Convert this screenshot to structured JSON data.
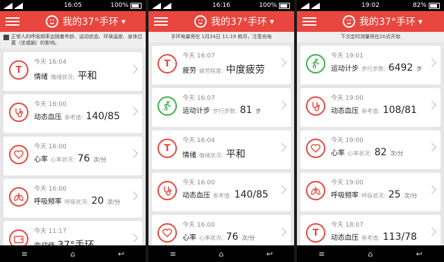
{
  "colors": {
    "accent": "#e8463e",
    "green": "#3cb14a"
  },
  "screens": [
    {
      "status": {
        "time": "16:05",
        "battery": "100%"
      },
      "app_title": "我的37°手环",
      "notice": "正常人的呼吸频率会随着年龄、运动状态、环境温度、身体位置（坐或躺）的影响。",
      "cards": [
        {
          "icon": "T",
          "icon_name": "mood-icon",
          "time": "今天 16:04",
          "name": "情绪",
          "label": "情绪状况:",
          "value": "平和",
          "unit": ""
        },
        {
          "icon": "bp",
          "icon_name": "stethoscope-icon",
          "time": "今天 16:00",
          "name": "动态血压",
          "label": "参考值:",
          "value": "140/85",
          "unit": ""
        },
        {
          "icon": "heart",
          "icon_name": "heart-icon",
          "time": "今天 16:00",
          "name": "心率",
          "label": "心率状况:",
          "value": "76",
          "unit": "次/分"
        },
        {
          "icon": "lung",
          "icon_name": "lungs-icon",
          "time": "今天 16:00",
          "name": "呼吸频率",
          "label": "呼吸状况:",
          "value": "20",
          "unit": "次/分"
        },
        {
          "icon": "wallet",
          "icon_name": "wallet-icon",
          "time": "今天 11:17",
          "name": "欢迎使",
          "label": "",
          "value": "37°手环",
          "unit": ""
        }
      ]
    },
    {
      "status": {
        "time": "16:16",
        "battery": "100%"
      },
      "app_title": "我的37°手环",
      "notice": "手环电量将在 1月24日 11:19 耗尽，注意充电",
      "cards": [
        {
          "icon": "T",
          "icon_name": "fatigue-icon",
          "time": "今天 16:07",
          "name": "疲劳",
          "label": "疲劳程度:",
          "value": "中度疲劳",
          "unit": ""
        },
        {
          "icon": "walk",
          "icon_name": "walking-icon",
          "time": "今天 16:07",
          "name": "运动计步",
          "label": "步行步数:",
          "value": "81",
          "unit": "步"
        },
        {
          "icon": "T",
          "icon_name": "mood-icon",
          "time": "今天 16:04",
          "name": "情绪",
          "label": "情绪状况:",
          "value": "平和",
          "unit": ""
        },
        {
          "icon": "bp",
          "icon_name": "stethoscope-icon",
          "time": "今天 16:00",
          "name": "动态血压",
          "label": "参考值:",
          "value": "140/85",
          "unit": ""
        },
        {
          "icon": "heart",
          "icon_name": "heart-icon",
          "time": "今天 16:00",
          "name": "心率",
          "label": "心率状况:",
          "value": "76",
          "unit": "次/分"
        }
      ]
    },
    {
      "status": {
        "time": "19:02",
        "battery": "82%"
      },
      "app_title": "我的37°手环",
      "notice": "下次定时测量将在20点开始",
      "cards": [
        {
          "icon": "walk",
          "icon_name": "walking-icon",
          "time": "今天 19:01",
          "name": "运动计步",
          "label": "步行步数:",
          "value": "6492",
          "unit": "步"
        },
        {
          "icon": "bp",
          "icon_name": "stethoscope-icon",
          "time": "今天 19:00",
          "name": "动态血压",
          "label": "参考值:",
          "value": "108/81",
          "unit": ""
        },
        {
          "icon": "heart",
          "icon_name": "heart-icon",
          "time": "今天 19:00",
          "name": "心率",
          "label": "心率状况:",
          "value": "82",
          "unit": "次/分"
        },
        {
          "icon": "lung",
          "icon_name": "lungs-icon",
          "time": "今天 19:00",
          "name": "呼吸频率",
          "label": "呼吸状况:",
          "value": "25",
          "unit": "次/分"
        },
        {
          "icon": "T",
          "icon_name": "bp-trend-icon",
          "time": "今天 18:07",
          "name": "动态血压",
          "label": "参考值:",
          "value": "113/78",
          "unit": ""
        }
      ]
    }
  ]
}
